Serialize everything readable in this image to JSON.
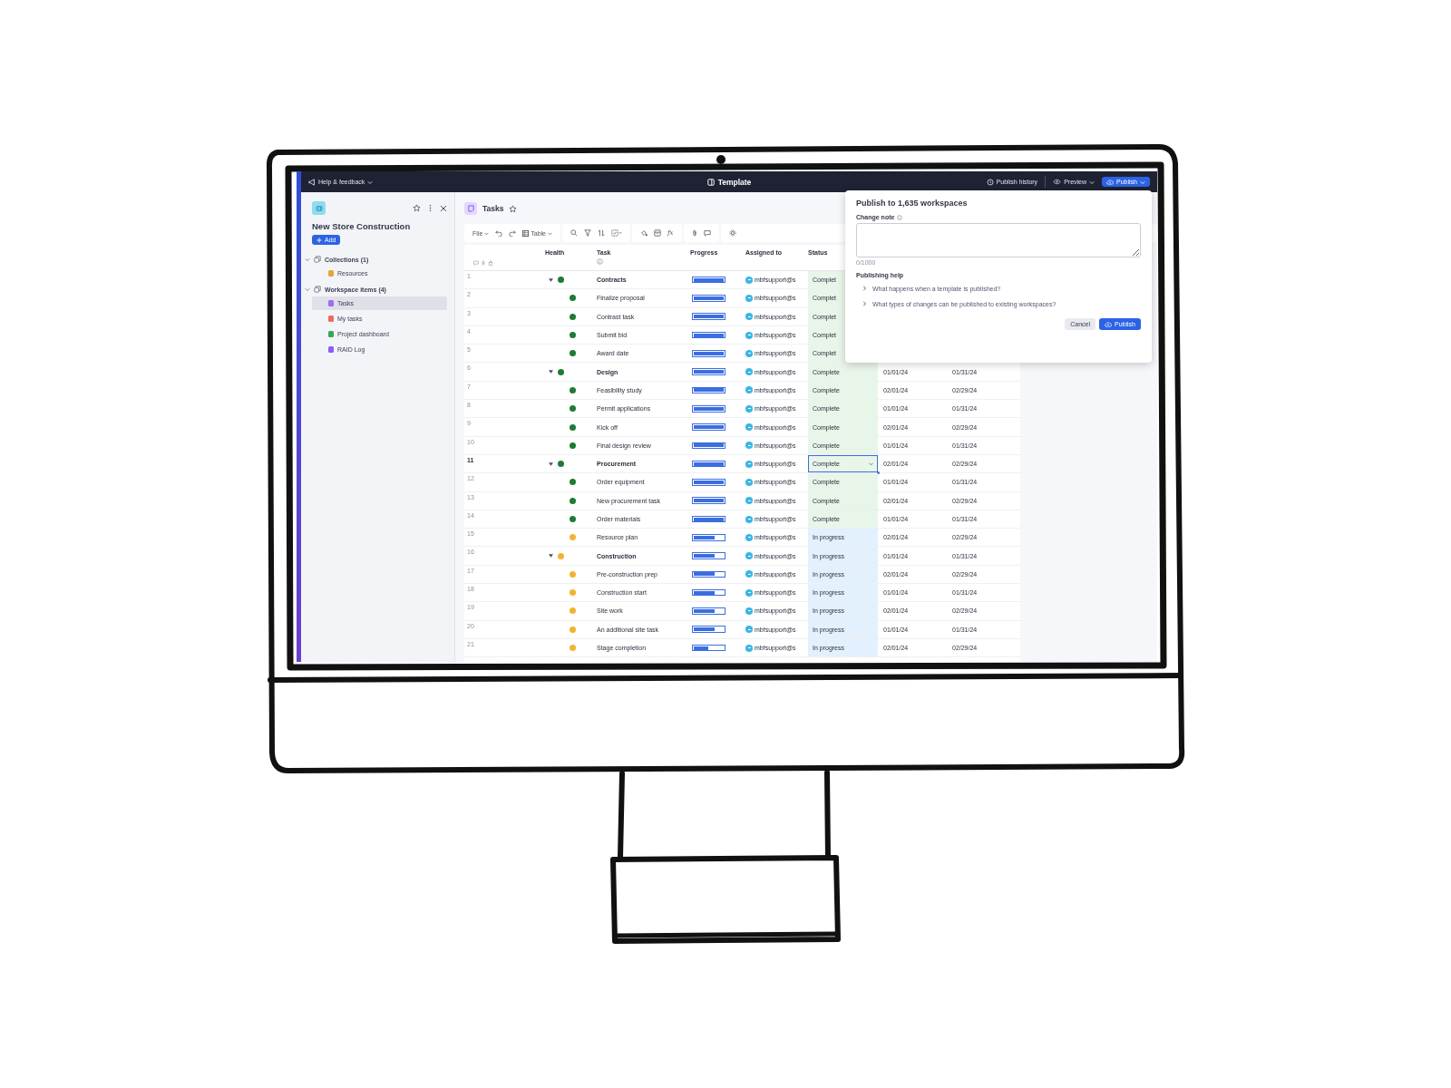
{
  "top_bar": {
    "help": "Help & feedback",
    "title": "Template",
    "history": "Publish history",
    "preview": "Preview",
    "publish": "Publish"
  },
  "sidebar": {
    "title": "New Store Construction",
    "add": "Add",
    "sections": [
      {
        "label": "Collections (1)",
        "expanded": true,
        "children": [
          {
            "label": "Resources",
            "selected": false,
            "color": "#e9a23b"
          }
        ]
      },
      {
        "label": "Workspace items (4)",
        "expanded": true,
        "children": [
          {
            "label": "Tasks",
            "selected": true,
            "color": "#9b6ef3"
          },
          {
            "label": "My tasks",
            "selected": false,
            "color": "#ec6a5e"
          },
          {
            "label": "Project dashboard",
            "selected": false,
            "color": "#34a853"
          },
          {
            "label": "RAID Log",
            "selected": false,
            "color": "#8b5cf6"
          }
        ]
      }
    ]
  },
  "page": {
    "title": "Tasks"
  },
  "toolbar": {
    "file": "File",
    "view": "Table",
    "formula": "fx"
  },
  "table": {
    "columns": [
      "Health",
      "Task",
      "Progress",
      "Assigned to",
      "Status"
    ],
    "rows": [
      {
        "num": "1",
        "kind": "group",
        "expanded": true,
        "health": {
          "color": "#1e7b34"
        },
        "task": "Contracts",
        "level": 1,
        "assignee": "mbfsupport@s",
        "status": {
          "text": "Complet",
          "color": "#e8f5e9"
        },
        "selected": false
      },
      {
        "num": "2",
        "kind": "task",
        "health": {
          "color": "#1e7b34"
        },
        "task": "Finalize proposal",
        "level": 1,
        "assignee": "mbfsupport@s",
        "status": {
          "text": "Complet",
          "color": "#e8f5e9"
        },
        "selected": false
      },
      {
        "num": "3",
        "kind": "task",
        "health": {
          "color": "#1e7b34"
        },
        "task": "Contrast task",
        "level": 1,
        "assignee": "mbfsupport@s",
        "status": {
          "text": "Complet",
          "color": "#e8f5e9"
        },
        "selected": false
      },
      {
        "num": "4",
        "kind": "task",
        "health": {
          "color": "#1e7b34"
        },
        "task": "Submit bid",
        "level": 1,
        "assignee": "mbfsupport@s",
        "status": {
          "text": "Complet",
          "color": "#e8f5e9"
        },
        "selected": false
      },
      {
        "num": "5",
        "kind": "task",
        "health": {
          "color": "#1e7b34"
        },
        "task": "Award date",
        "level": 1,
        "assignee": "mbfsupport@s",
        "status": {
          "text": "Complet",
          "color": "#e8f5e9"
        },
        "selected": false
      },
      {
        "num": "6",
        "kind": "group",
        "expanded": true,
        "health": {
          "color": "#1e7b34"
        },
        "task": "Design",
        "level": 1,
        "assignee": "mbfsupport@s",
        "status": {
          "text": "Complete",
          "color": "#e8f5e9"
        },
        "selected": false,
        "start": "01/01/24",
        "end": "01/31/24"
      },
      {
        "num": "7",
        "kind": "task",
        "health": {
          "color": "#1e7b34"
        },
        "task": "Feasibility study",
        "level": 1,
        "assignee": "mbfsupport@s",
        "status": {
          "text": "Complete",
          "color": "#e8f5e9"
        },
        "selected": false,
        "start": "02/01/24",
        "end": "02/29/24"
      },
      {
        "num": "8",
        "kind": "task",
        "health": {
          "color": "#1e7b34"
        },
        "task": "Permit applications",
        "level": 1,
        "assignee": "mbfsupport@s",
        "status": {
          "text": "Complete",
          "color": "#e8f5e9"
        },
        "selected": false,
        "start": "01/01/24",
        "end": "01/31/24"
      },
      {
        "num": "9",
        "kind": "task",
        "health": {
          "color": "#1e7b34"
        },
        "task": "Kick off",
        "level": 1,
        "assignee": "mbfsupport@s",
        "status": {
          "text": "Complete",
          "color": "#e8f5e9"
        },
        "selected": false,
        "start": "02/01/24",
        "end": "02/29/24"
      },
      {
        "num": "10",
        "kind": "task",
        "health": {
          "color": "#1e7b34"
        },
        "task": "Final design review",
        "level": 1,
        "assignee": "mbfsupport@s",
        "status": {
          "text": "Complete",
          "color": "#e8f5e9"
        },
        "selected": false,
        "start": "01/01/24",
        "end": "01/31/24"
      },
      {
        "num": "11",
        "kind": "group",
        "expanded": true,
        "health": {
          "color": "#1e7b34"
        },
        "task": "Procurement",
        "level": 1,
        "assignee": "mbfsupport@s",
        "status": {
          "text": "Complete",
          "color": "#e8f5e9"
        },
        "selected": true,
        "start": "02/01/24",
        "end": "02/29/24"
      },
      {
        "num": "12",
        "kind": "task",
        "health": {
          "color": "#1e7b34"
        },
        "task": "Order equipment",
        "level": 1,
        "assignee": "mbfsupport@s",
        "status": {
          "text": "Complete",
          "color": "#e8f5e9"
        },
        "selected": false,
        "start": "01/01/24",
        "end": "01/31/24"
      },
      {
        "num": "13",
        "kind": "task",
        "health": {
          "color": "#1e7b34"
        },
        "task": "New procurement task",
        "level": 1,
        "assignee": "mbfsupport@s",
        "status": {
          "text": "Complete",
          "color": "#e8f5e9"
        },
        "selected": false,
        "start": "02/01/24",
        "end": "02/29/24"
      },
      {
        "num": "14",
        "kind": "task",
        "health": {
          "color": "#1e7b34"
        },
        "task": "Order materials",
        "level": 1,
        "assignee": "mbfsupport@s",
        "status": {
          "text": "Complete",
          "color": "#e8f5e9"
        },
        "selected": false,
        "start": "01/01/24",
        "end": "01/31/24"
      },
      {
        "num": "15",
        "kind": "task",
        "health": {
          "color": "#f2b233"
        },
        "task": "Resource plan",
        "level": 0.7,
        "assignee": "mbfsupport@s",
        "status": {
          "text": "In progress",
          "color": "#e3f0fd"
        },
        "selected": false,
        "start": "02/01/24",
        "end": "02/29/24"
      },
      {
        "num": "16",
        "kind": "group",
        "expanded": true,
        "health": {
          "color": "#f2b233"
        },
        "task": "Construction",
        "level": 0.7,
        "assignee": "mbfsupport@s",
        "status": {
          "text": "In progress",
          "color": "#e3f0fd"
        },
        "selected": false,
        "start": "01/01/24",
        "end": "01/31/24"
      },
      {
        "num": "17",
        "kind": "task",
        "health": {
          "color": "#f2b233"
        },
        "task": "Pre-construction prep",
        "level": 0.7,
        "assignee": "mbfsupport@s",
        "status": {
          "text": "In progress",
          "color": "#e3f0fd"
        },
        "selected": false,
        "start": "02/01/24",
        "end": "02/29/24"
      },
      {
        "num": "18",
        "kind": "task",
        "health": {
          "color": "#f2b233"
        },
        "task": "Construction start",
        "level": 0.7,
        "assignee": "mbfsupport@s",
        "status": {
          "text": "In progress",
          "color": "#e3f0fd"
        },
        "selected": false,
        "start": "01/01/24",
        "end": "01/31/24"
      },
      {
        "num": "19",
        "kind": "task",
        "health": {
          "color": "#f2b233"
        },
        "task": "Site work",
        "level": 0.7,
        "assignee": "mbfsupport@s",
        "status": {
          "text": "In progress",
          "color": "#e3f0fd"
        },
        "selected": false,
        "start": "02/01/24",
        "end": "02/29/24"
      },
      {
        "num": "20",
        "kind": "task",
        "health": {
          "color": "#f2b233"
        },
        "task": "An additional site task",
        "level": 0.7,
        "assignee": "mbfsupport@s",
        "status": {
          "text": "In progress",
          "color": "#e3f0fd"
        },
        "selected": false,
        "start": "01/01/24",
        "end": "01/31/24"
      },
      {
        "num": "21",
        "kind": "task",
        "health": {
          "color": "#f2b233"
        },
        "task": "Stage completion",
        "level": 0.5,
        "assignee": "mbfsupport@s",
        "status": {
          "text": "In progress",
          "color": "#e3f0fd"
        },
        "selected": false,
        "start": "02/01/24",
        "end": "02/29/24"
      }
    ]
  },
  "dialog": {
    "title": "Publish to 1,635 workspaces",
    "note_label": "Change note",
    "counter": "0/1000",
    "help_title": "Publishing help",
    "questions": [
      {
        "label": "What happens when a template is published?",
        "expanded": false
      },
      {
        "label": "What types of changes can be published to existing workspaces?",
        "expanded": false
      }
    ],
    "cancel": "Cancel",
    "publish": "Publish"
  }
}
